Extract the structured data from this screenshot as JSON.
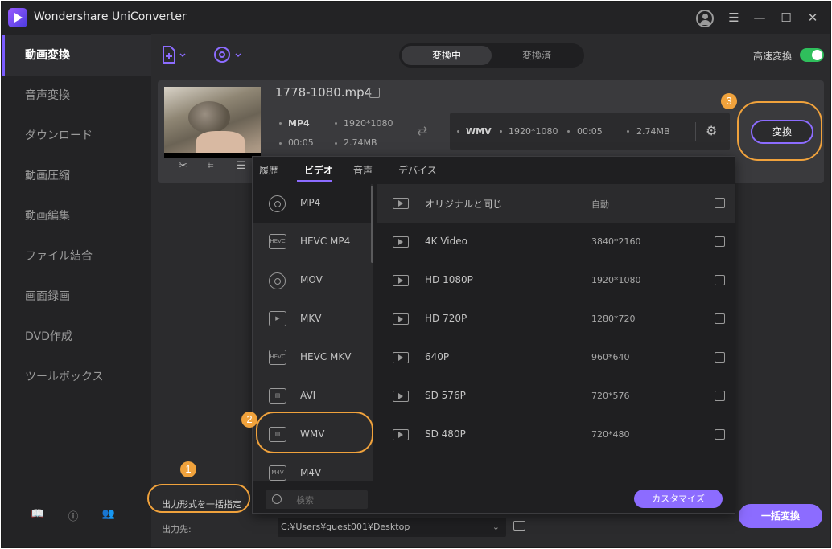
{
  "app": {
    "title": "Wondershare UniConverter"
  },
  "sidebar": {
    "items": [
      {
        "label": "動画変換",
        "active": true
      },
      {
        "label": "音声変換"
      },
      {
        "label": "ダウンロード"
      },
      {
        "label": "動画圧縮"
      },
      {
        "label": "動画編集"
      },
      {
        "label": "ファイル結合"
      },
      {
        "label": "画面録画"
      },
      {
        "label": "DVD作成"
      },
      {
        "label": "ツールボックス"
      }
    ]
  },
  "header": {
    "tabs": [
      {
        "label": "変換中",
        "active": true
      },
      {
        "label": "変換済"
      }
    ],
    "fast_convert_label": "高速変換",
    "fast_convert_on": true
  },
  "file": {
    "name": "1778-1080.mp4",
    "source": {
      "format": "MP4",
      "resolution": "1920*1080",
      "duration": "00:05",
      "size": "2.74MB"
    },
    "target": {
      "format": "WMV",
      "resolution": "1920*1080",
      "duration": "00:05",
      "size": "2.74MB"
    },
    "convert_label": "変換"
  },
  "popup": {
    "tabs": [
      {
        "label": "履歴"
      },
      {
        "label": "ビデオ",
        "active": true
      },
      {
        "label": "音声"
      },
      {
        "label": "デバイス"
      }
    ],
    "formats": [
      {
        "label": "MP4",
        "icon": "disc-icon",
        "active": true
      },
      {
        "label": "HEVC MP4",
        "icon": "hevc-icon",
        "badge": "HEVC"
      },
      {
        "label": "MOV",
        "icon": "disc-icon"
      },
      {
        "label": "MKV",
        "icon": "film-icon"
      },
      {
        "label": "HEVC MKV",
        "icon": "hevc-icon",
        "badge": "HEVC"
      },
      {
        "label": "AVI",
        "icon": "clapper-icon"
      },
      {
        "label": "WMV",
        "icon": "clapper-icon"
      },
      {
        "label": "M4V",
        "icon": "m4v-icon",
        "badge": "M4V"
      }
    ],
    "resolutions": [
      {
        "name": "オリジナルと同じ",
        "value": "自動",
        "active": true
      },
      {
        "name": "4K Video",
        "value": "3840*2160"
      },
      {
        "name": "HD 1080P",
        "value": "1920*1080"
      },
      {
        "name": "HD 720P",
        "value": "1280*720"
      },
      {
        "name": "640P",
        "value": "960*640"
      },
      {
        "name": "SD 576P",
        "value": "720*576"
      },
      {
        "name": "SD 480P",
        "value": "720*480"
      }
    ],
    "search_placeholder": "検索",
    "customize_label": "カスタマイズ"
  },
  "bottom": {
    "output_format_label": "出力形式を一括指定",
    "output_dest_label": "出力先:",
    "path": "C:¥Users¥guest001¥Desktop",
    "batch_convert_label": "一括変換"
  },
  "annotations": [
    {
      "number": "1"
    },
    {
      "number": "2"
    },
    {
      "number": "3"
    }
  ],
  "colors": {
    "accent": "#8c6cff",
    "annotation": "#f0a23c",
    "toggle_on": "#2fbf5c"
  }
}
